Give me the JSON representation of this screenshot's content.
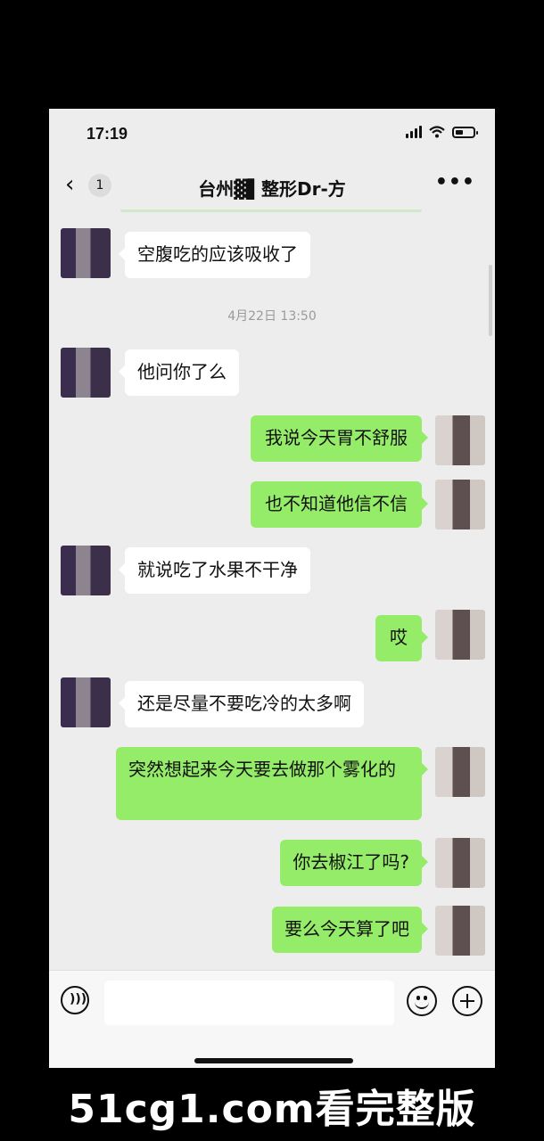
{
  "status_bar": {
    "time": "17:19"
  },
  "header": {
    "back_symbol": "‹",
    "unread_count": "1",
    "title": "台州▓▌整形Dr-方",
    "more_symbol": "•••"
  },
  "messages": [
    {
      "side": "in",
      "text": "空腹吃的应该吸收了"
    },
    {
      "side": "in",
      "text": "他问你了么"
    },
    {
      "side": "out",
      "text": "我说今天胃不舒服"
    },
    {
      "side": "out",
      "text": "也不知道他信不信"
    },
    {
      "side": "in",
      "text": "就说吃了水果不干净"
    },
    {
      "side": "out",
      "text": "哎"
    },
    {
      "side": "in",
      "text": "还是尽量不要吃冷的太多啊"
    },
    {
      "side": "out",
      "text": "突然想起来今天要去做那个雾化的"
    },
    {
      "side": "out",
      "text": "你去椒江了吗?"
    },
    {
      "side": "out",
      "text": "要么今天算了吧"
    }
  ],
  "timestamp": "4月22日 13:50",
  "input_bar": {
    "voice_icon": "voice-icon",
    "emoji_icon": "emoji-icon",
    "plus_icon": "plus-icon"
  },
  "watermark": "51cg1.com看完整版",
  "colors": {
    "outgoing_bubble": "#95ec69",
    "incoming_bubble": "#ffffff",
    "chat_bg": "#ededed"
  }
}
